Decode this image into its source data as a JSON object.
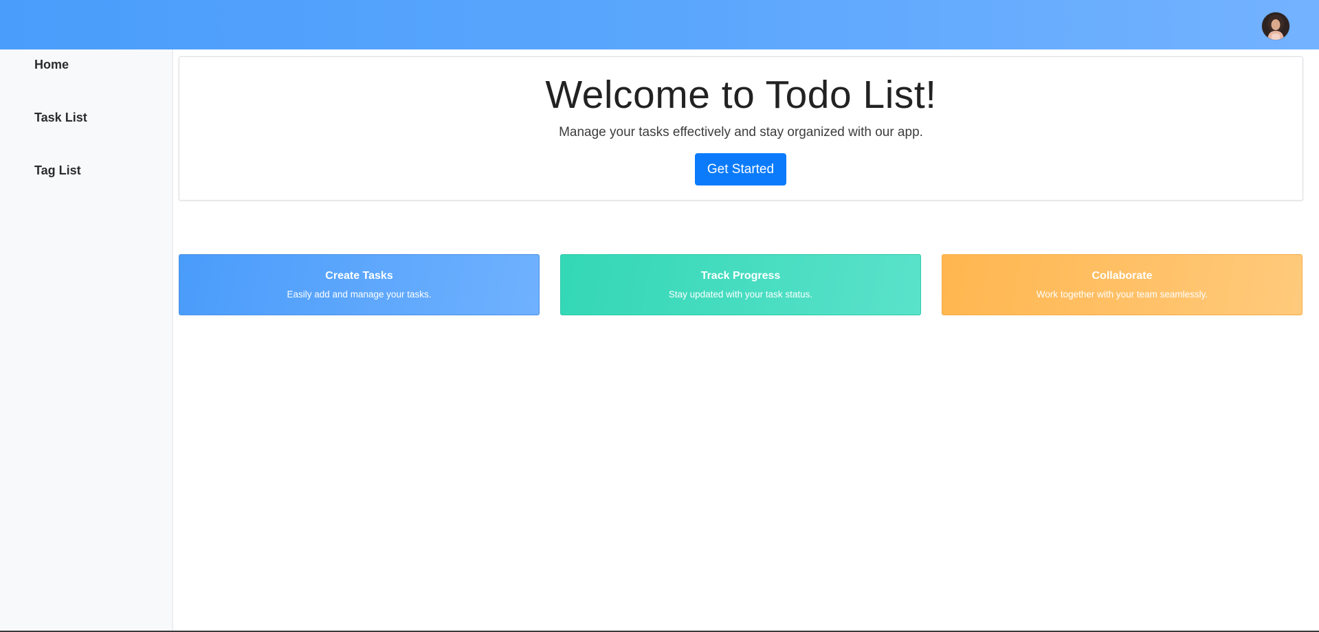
{
  "colors": {
    "topbar_start": "#4a9dfb",
    "topbar_end": "#73b2ff",
    "primary_button": "#0b7bfb",
    "card_blue": "#4a9cfb",
    "card_green": "#33d7b6",
    "card_orange": "#ffb64f"
  },
  "header": {
    "avatar_icon": "user-avatar"
  },
  "sidebar": {
    "items": [
      {
        "label": "Home"
      },
      {
        "label": "Task List"
      },
      {
        "label": "Tag List"
      }
    ]
  },
  "hero": {
    "title": "Welcome to Todo List!",
    "subtitle": "Manage your tasks effectively and stay organized with our app.",
    "button_label": "Get Started"
  },
  "features": [
    {
      "title": "Create Tasks",
      "text": "Easily add and manage your tasks."
    },
    {
      "title": "Track Progress",
      "text": "Stay updated with your task status."
    },
    {
      "title": "Collaborate",
      "text": "Work together with your team seamlessly."
    }
  ]
}
